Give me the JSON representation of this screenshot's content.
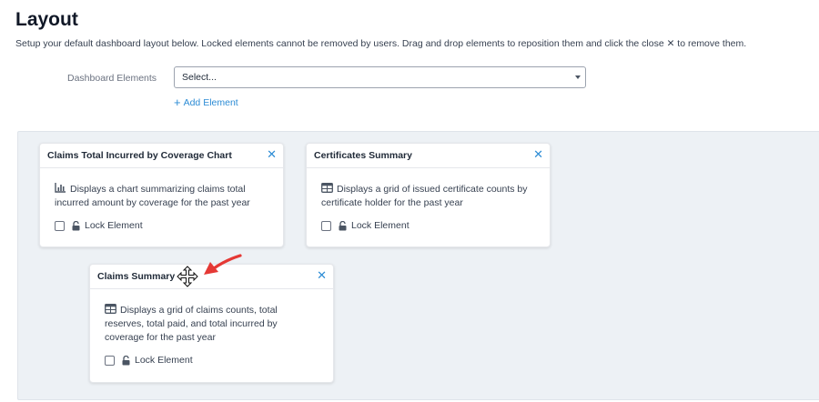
{
  "page": {
    "title": "Layout",
    "description": "Setup your default dashboard layout below. Locked elements cannot be removed by users. Drag and drop elements to reposition them and click the close ✕ to remove them."
  },
  "form": {
    "label": "Dashboard Elements",
    "select_value": "Select...",
    "add_label": "Add Element"
  },
  "cards": [
    {
      "title": "Claims Total Incurred by Coverage Chart",
      "icon": "bar-chart-icon",
      "description": "Displays a chart summarizing claims total incurred amount by coverage for the past year",
      "lock_label": "Lock Element",
      "locked": false
    },
    {
      "title": "Certificates Summary",
      "icon": "table-icon",
      "description": "Displays a grid of issued certificate counts by certificate holder for the past year",
      "lock_label": "Lock Element",
      "locked": false
    },
    {
      "title": "Claims Summary",
      "icon": "table-icon",
      "description": "Displays a grid of claims counts, total reserves, total paid, and total incurred by coverage for the past year",
      "lock_label": "Lock Element",
      "locked": false
    }
  ],
  "colors": {
    "accent": "#2d8cd5",
    "canvas_bg": "#edf1f5",
    "annotation_arrow": "#e53935"
  },
  "close_symbol": "✕"
}
